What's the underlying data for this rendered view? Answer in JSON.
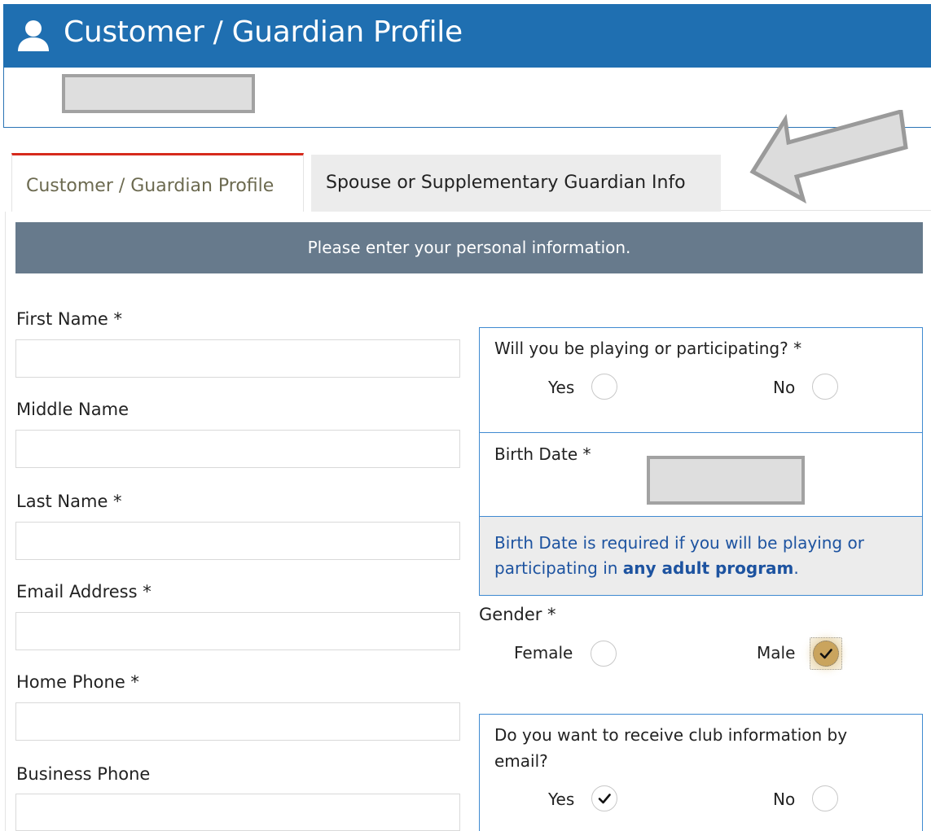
{
  "header": {
    "title": "Customer / Guardian Profile",
    "icon": "user-icon"
  },
  "tabs": [
    {
      "label": "Customer / Guardian Profile",
      "active": true
    },
    {
      "label": "Spouse or Supplementary Guardian Info",
      "active": false
    }
  ],
  "banner": "Please enter your personal information.",
  "fields": [
    {
      "label": "First Name *",
      "value": ""
    },
    {
      "label": "Middle Name",
      "value": ""
    },
    {
      "label": "Last Name *",
      "value": ""
    },
    {
      "label": "Email Address *",
      "value": ""
    },
    {
      "label": "Home Phone *",
      "value": ""
    },
    {
      "label": "Business Phone",
      "value": ""
    }
  ],
  "participating": {
    "question": "Will you be playing or participating? *",
    "yes": "Yes",
    "no": "No",
    "selected": null
  },
  "birth_date": {
    "label": "Birth Date *",
    "note_prefix": "Birth Date is required if you will be playing or participating in ",
    "note_bold": "any adult program",
    "note_suffix": "."
  },
  "gender": {
    "label": "Gender *",
    "female": "Female",
    "male": "Male",
    "selected": "Male"
  },
  "club_email": {
    "question_line1": "Do you want to receive club information by",
    "question_line2": "email?",
    "yes": "Yes",
    "no": "No",
    "selected": "Yes"
  },
  "colors": {
    "header_blue": "#1f6fb1",
    "banner_gray": "#677a8c",
    "tab_active_red": "#d62a1c",
    "panel_border": "#3f8ad1",
    "note_blue": "#1d53a0",
    "male_gold": "#caa45d"
  }
}
